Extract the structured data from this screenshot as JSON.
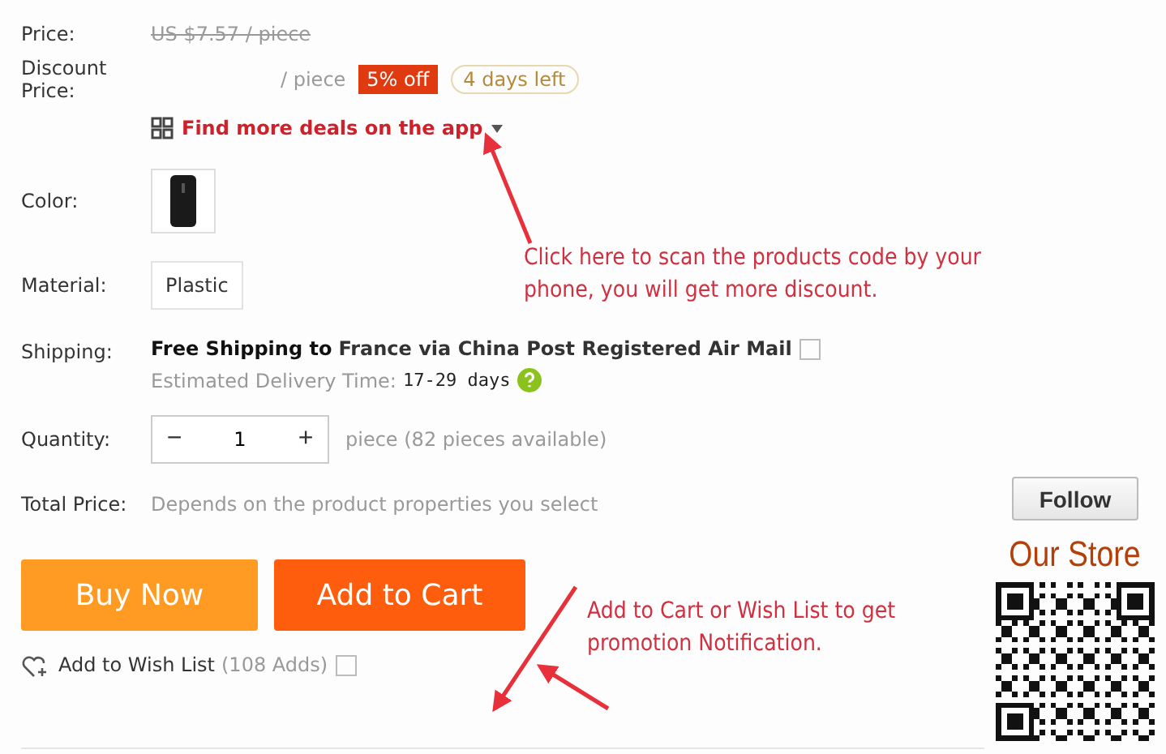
{
  "price": {
    "label": "Price:",
    "original": "US $7.57 / piece"
  },
  "discount": {
    "label_lines": [
      "Discount",
      "Price:"
    ],
    "unit": "/ piece",
    "badge": "5% off",
    "time_left": "4 days left"
  },
  "app_deals": {
    "text": "Find more deals on the app"
  },
  "options": [
    {
      "kind": "swatch",
      "label": "Color:"
    },
    {
      "kind": "chip",
      "label": "Material:",
      "value": "Plastic"
    }
  ],
  "shipping": {
    "label": "Shipping:",
    "lead": "Free Shipping to",
    "destination": "France via China Post Registered Air Mail",
    "estimate_label": "Estimated Delivery Time:",
    "estimate": "17-29 days"
  },
  "quantity": {
    "label": "Quantity:",
    "minus": "−",
    "value": "1",
    "plus": "+",
    "note": "piece (82 pieces available)"
  },
  "total": {
    "label": "Total Price:",
    "note": "Depends on the product properties you select"
  },
  "buttons": [
    {
      "kind": "primary",
      "label": "Buy Now"
    },
    {
      "kind": "secondary",
      "label": "Add to Cart"
    }
  ],
  "wishlist": {
    "label": "Add to Wish List",
    "count": "(108 Adds)"
  },
  "store": {
    "follow": "Follow",
    "title": "Our Store"
  },
  "annotations": [
    {
      "kind": "scan",
      "text": "Click here to scan the products code by your phone, you will get more discount."
    },
    {
      "kind": "cart",
      "text": "Add to Cart or Wish List to get promotion Notification."
    }
  ]
}
